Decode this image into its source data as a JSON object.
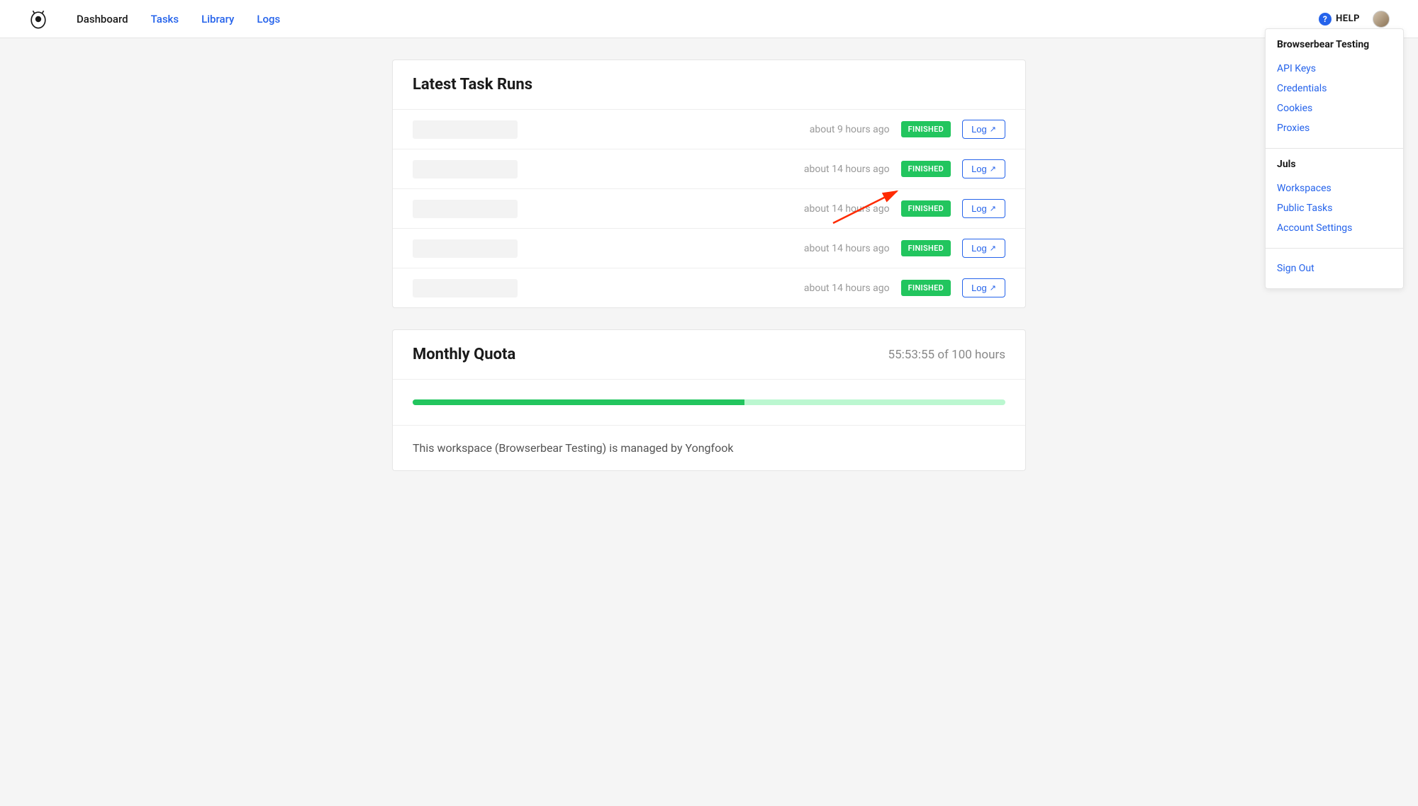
{
  "nav": {
    "dashboard": "Dashboard",
    "tasks": "Tasks",
    "library": "Library",
    "logs": "Logs"
  },
  "help": {
    "label": "HELP"
  },
  "dropdown": {
    "section1": {
      "title": "Browserbear Testing",
      "links": [
        "API Keys",
        "Credentials",
        "Cookies",
        "Proxies"
      ]
    },
    "section2": {
      "title": "Juls",
      "links": [
        "Workspaces",
        "Public Tasks",
        "Account Settings"
      ]
    },
    "section3": {
      "links": [
        "Sign Out"
      ]
    }
  },
  "latest_runs": {
    "title": "Latest Task Runs",
    "log_label": "Log",
    "rows": [
      {
        "time": "about 9 hours ago",
        "status": "FINISHED"
      },
      {
        "time": "about 14 hours ago",
        "status": "FINISHED"
      },
      {
        "time": "about 14 hours ago",
        "status": "FINISHED"
      },
      {
        "time": "about 14 hours ago",
        "status": "FINISHED"
      },
      {
        "time": "about 14 hours ago",
        "status": "FINISHED"
      }
    ]
  },
  "quota": {
    "title": "Monthly Quota",
    "summary": "55:53:55 of 100 hours",
    "percent": 56,
    "footer": "This workspace (Browserbear Testing) is managed by Yongfook"
  }
}
